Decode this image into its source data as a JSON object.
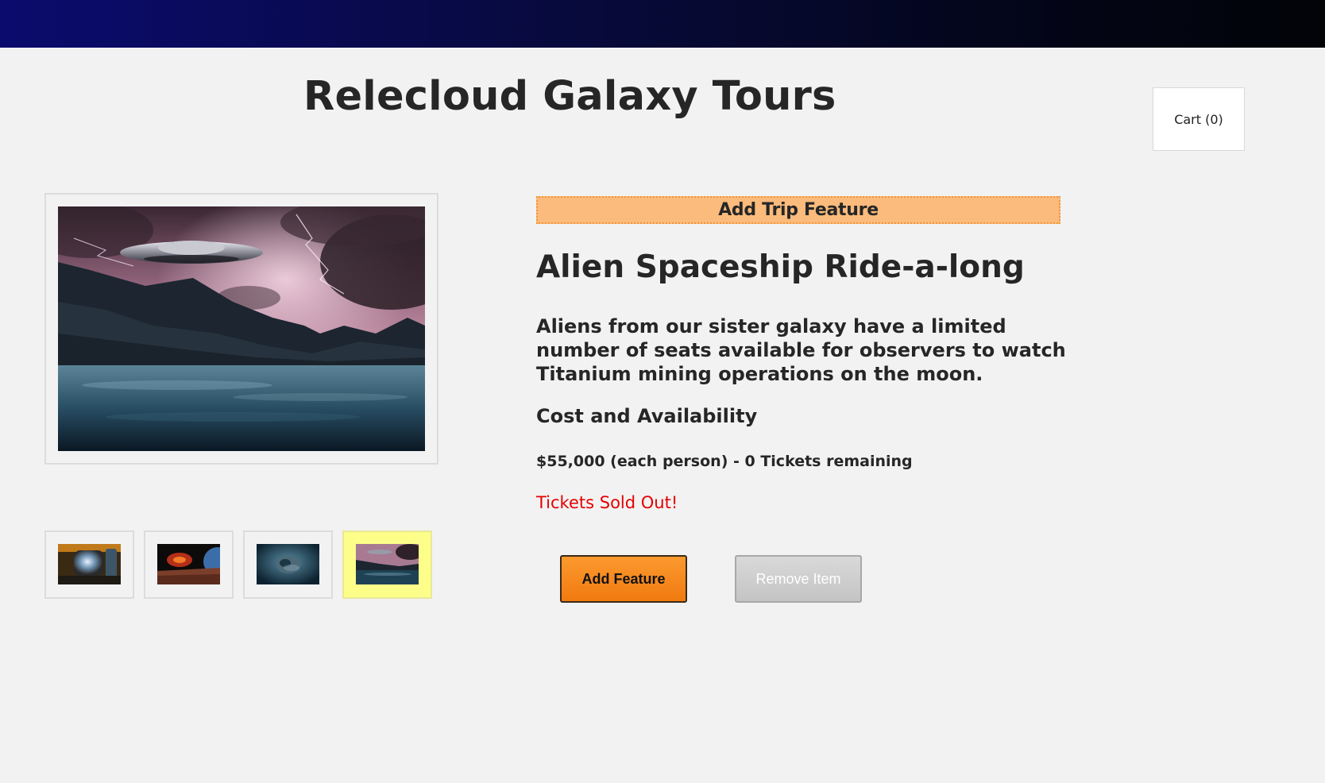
{
  "header": {
    "site_title": "Relecloud Galaxy Tours",
    "cart_label": "Cart (0)"
  },
  "gallery": {
    "main_image_icon": "ufo-over-lake-image",
    "thumbnails": [
      {
        "icon": "spaceship-window-image",
        "selected": false
      },
      {
        "icon": "planet-surface-image",
        "selected": false
      },
      {
        "icon": "underwater-spacecraft-image",
        "selected": false
      },
      {
        "icon": "ufo-over-lake-image",
        "selected": true
      }
    ],
    "selected_color": "#fdfd8a"
  },
  "feature": {
    "banner_label": "Add Trip Feature",
    "title": "Alien Spaceship Ride-a-long",
    "description": "Aliens from our sister galaxy have a limited number of seats available for observers to watch Titanium mining operations on the moon.",
    "cost_heading": "Cost and Availability",
    "price_line": "$55,000 (each person) - 0 Tickets remaining",
    "status_text": "Tickets Sold Out!",
    "status_color": "#e60000"
  },
  "actions": {
    "add_label": "Add Feature",
    "remove_label": "Remove Item",
    "accent_color": "#f07a10"
  }
}
